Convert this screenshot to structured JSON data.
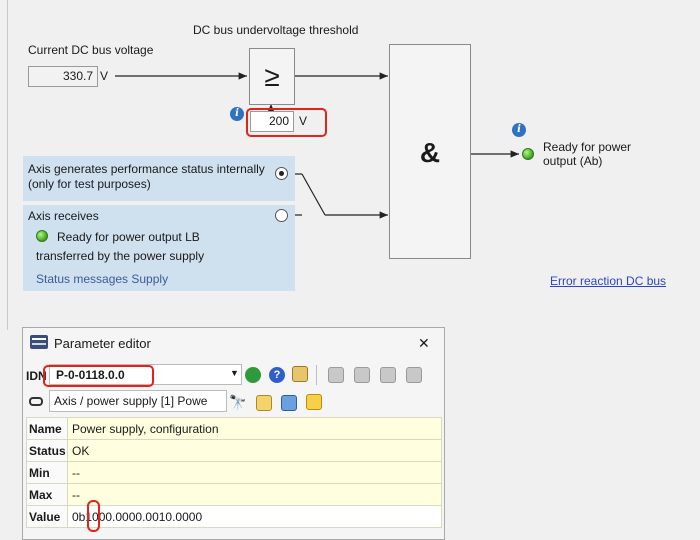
{
  "diagram": {
    "threshold_title": "DC bus undervoltage threshold",
    "current_voltage_label": "Current DC bus voltage",
    "current_voltage_value": "330.7",
    "unit_v": "V",
    "comparator_symbol": "≥",
    "threshold_value": "200",
    "and_symbol": "&",
    "output_label_line1": "Ready for power",
    "output_label_line2": "output (Ab)",
    "option1_line1": "Axis generates performance status internally",
    "option1_line2": "(only for test purposes)",
    "option2_title": "Axis receives",
    "option2_led_text": "Ready for power output LB",
    "option2_line2": "transferred by  the power supply",
    "status_messages_link": "Status messages Supply",
    "error_reaction_link": "Error reaction DC bus",
    "info_glyph": "i"
  },
  "parameter_editor": {
    "title": "Parameter editor",
    "close_glyph": "✕",
    "idn_label": "IDN",
    "idn_value": "P-0-0118.0.0",
    "axis_dropdown": "Axis / power supply [1] Powe",
    "rows": [
      {
        "key": "Name",
        "value": "Power supply, configuration"
      },
      {
        "key": "Status",
        "value": "OK"
      },
      {
        "key": "Min",
        "value": "--"
      },
      {
        "key": "Max",
        "value": "--"
      },
      {
        "key": "Value",
        "value": "0b1000.0000.0010.0000"
      }
    ]
  },
  "colors": {
    "panel_bg": "#cfe0ee",
    "highlight": "#e0241c",
    "link": "#2b45c9",
    "led_green": "#3aa31c"
  }
}
